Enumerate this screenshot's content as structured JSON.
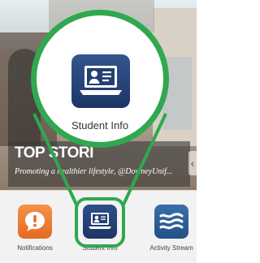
{
  "top_story": {
    "title": "TOP STORI",
    "subtitle": "Promoting a healthier lifestyle, @DowneyUnif...",
    "next_arrow": "‹"
  },
  "magnified": {
    "label": "Student Info",
    "icon": "student-info-icon"
  },
  "apps": [
    {
      "label": "Notifications",
      "icon": "notification-bubble-icon",
      "color": "#EE7A33"
    },
    {
      "label": "Student Info",
      "icon": "student-info-icon",
      "color": "#23406F"
    },
    {
      "label": "Activity Stream",
      "icon": "waves-icon",
      "color": "#2E5F97"
    }
  ],
  "colors": {
    "highlight": "#2FA84F",
    "tray": "#F2F2F2"
  }
}
